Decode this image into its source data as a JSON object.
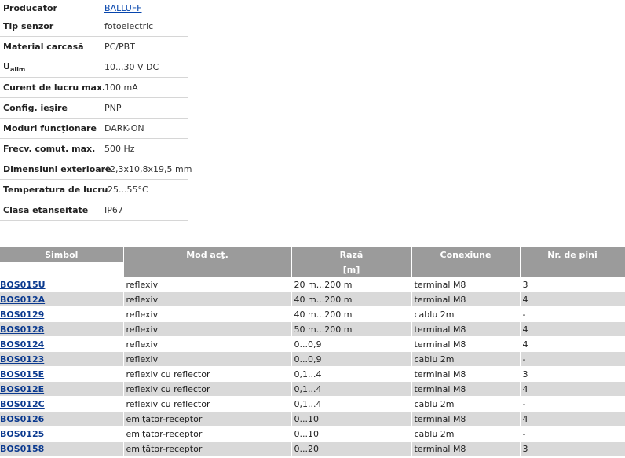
{
  "specs": [
    {
      "label": "Producător",
      "value": "BALLUFF",
      "link": true
    },
    {
      "label": "Tip senzor",
      "value": "fotoelectric"
    },
    {
      "label": "Material carcasă",
      "value": "PC/PBT"
    },
    {
      "label_main": "U",
      "label_sub": "alim",
      "value": "10...30 V DC"
    },
    {
      "label": "Curent de lucru max.",
      "value": "100 mA"
    },
    {
      "label": "Config. ieşire",
      "value": "PNP"
    },
    {
      "label": "Moduri funcţionare",
      "value": "DARK-ON"
    },
    {
      "label": "Frecv. comut. max.",
      "value": "500 Hz"
    },
    {
      "label": "Dimensiuni exterioare",
      "value": "42,3x10,8x19,5 mm"
    },
    {
      "label": "Temperatura de lucru",
      "value": "-25...55°C"
    },
    {
      "label": "Clasă etanşeitate",
      "value": "IP67"
    }
  ],
  "table": {
    "headers": [
      "Simbol",
      "Mod acţ.",
      "Rază",
      "Conexiune",
      "Nr. de pini"
    ],
    "unit": "[m]",
    "rows": [
      [
        "BOS015U",
        "reflexiv",
        "20 m...200 m",
        "terminal M8",
        "3"
      ],
      [
        "BOS012A",
        "reflexiv",
        "40 m...200 m",
        "terminal M8",
        "4"
      ],
      [
        "BOS0129",
        "reflexiv",
        "40 m...200 m",
        "cablu 2m",
        "-"
      ],
      [
        "BOS0128",
        "reflexiv",
        "50 m...200 m",
        "terminal M8",
        "4"
      ],
      [
        "BOS0124",
        "reflexiv",
        "0...0,9",
        "terminal M8",
        "4"
      ],
      [
        "BOS0123",
        "reflexiv",
        "0...0,9",
        "cablu 2m",
        "-"
      ],
      [
        "BOS015E",
        "reflexiv cu reflector",
        "0,1...4",
        "terminal M8",
        "3"
      ],
      [
        "BOS012E",
        "reflexiv cu reflector",
        "0,1...4",
        "terminal M8",
        "4"
      ],
      [
        "BOS012C",
        "reflexiv cu reflector",
        "0,1...4",
        "cablu 2m",
        "-"
      ],
      [
        "BOS0126",
        "emiţător-receptor",
        "0...10",
        "terminal M8",
        "4"
      ],
      [
        "BOS0125",
        "emiţător-receptor",
        "0...10",
        "cablu 2m",
        "-"
      ],
      [
        "BOS0158",
        "emiţător-receptor",
        "0...20",
        "terminal M8",
        "3"
      ]
    ]
  }
}
